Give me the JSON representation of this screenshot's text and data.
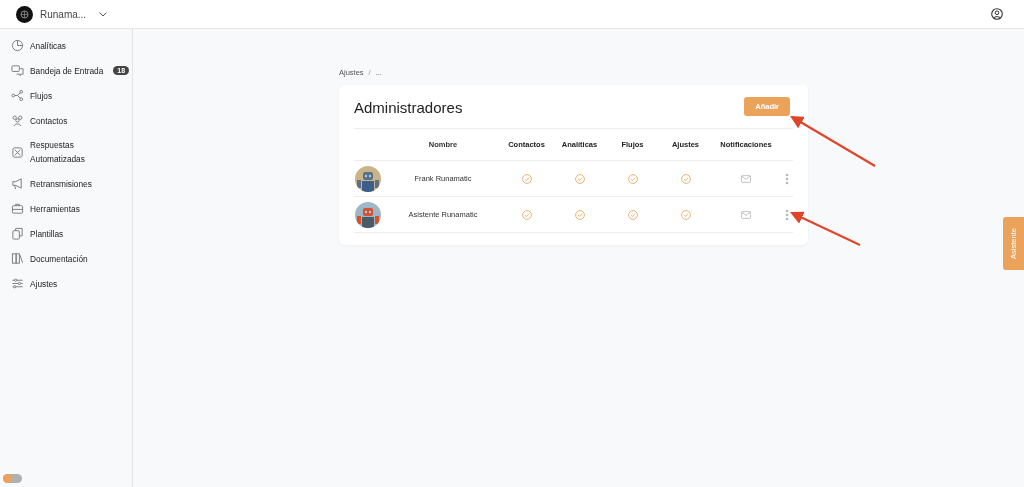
{
  "workspace": {
    "name": "Runama..."
  },
  "sidebar": {
    "items": [
      {
        "label": "Analíticas"
      },
      {
        "label": "Bandeja de Entrada",
        "badge": "18"
      },
      {
        "label": "Flujos"
      },
      {
        "label": "Contactos"
      },
      {
        "label": "Respuestas Automatizadas"
      },
      {
        "label": "Retransmisiones"
      },
      {
        "label": "Herramientas"
      },
      {
        "label": "Plantillas"
      },
      {
        "label": "Documentación"
      },
      {
        "label": "Ajustes"
      }
    ]
  },
  "theme_toggle": {
    "on": false
  },
  "breadcrumb": {
    "items": [
      "Ajustes",
      "..."
    ],
    "separator": "/"
  },
  "card": {
    "title": "Administradores",
    "add_button": "Añadir",
    "table": {
      "columns": [
        "Nombre",
        "Contactos",
        "Analíticas",
        "Flujos",
        "Ajustes",
        "Notificaciones"
      ],
      "rows": [
        {
          "name": "Frank Runamatic",
          "permissions": [
            true,
            true,
            true,
            true
          ],
          "notifications": false
        },
        {
          "name": "Asistente Runamatic",
          "permissions": [
            true,
            true,
            true,
            true
          ],
          "notifications": false
        }
      ]
    }
  },
  "side_tab": "Asistente"
}
